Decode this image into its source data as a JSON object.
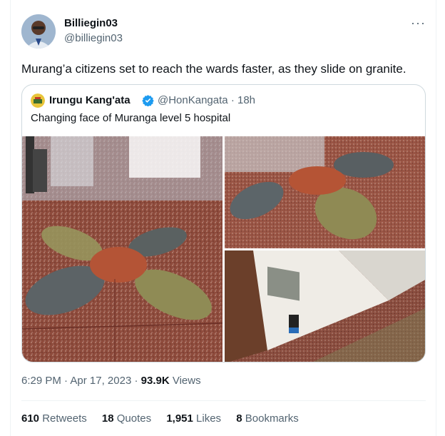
{
  "author": {
    "name": "Billiegin03",
    "handle": "@billiegin03"
  },
  "tweet": {
    "text": "Murang’a citizens set to reach the wards faster, as they slide on granite."
  },
  "quote": {
    "name": "Irungu Kang'ata",
    "handle": "@HonKangata",
    "separator": "·",
    "time": "18h",
    "text": "Changing face of Muranga level 5 hospital",
    "verified_color": "#1d9bf0"
  },
  "meta": {
    "time": "6:29 PM",
    "dot": "·",
    "date": "Apr 17, 2023",
    "views_count": "93.9K",
    "views_label": "Views"
  },
  "stats": {
    "retweets_count": "610",
    "retweets_label": "Retweets",
    "quotes_count": "18",
    "quotes_label": "Quotes",
    "likes_count": "1,951",
    "likes_label": "Likes",
    "bookmarks_count": "8",
    "bookmarks_label": "Bookmarks"
  },
  "icons": {
    "more": "more-horizontal-icon",
    "verified": "verified-badge-icon"
  }
}
